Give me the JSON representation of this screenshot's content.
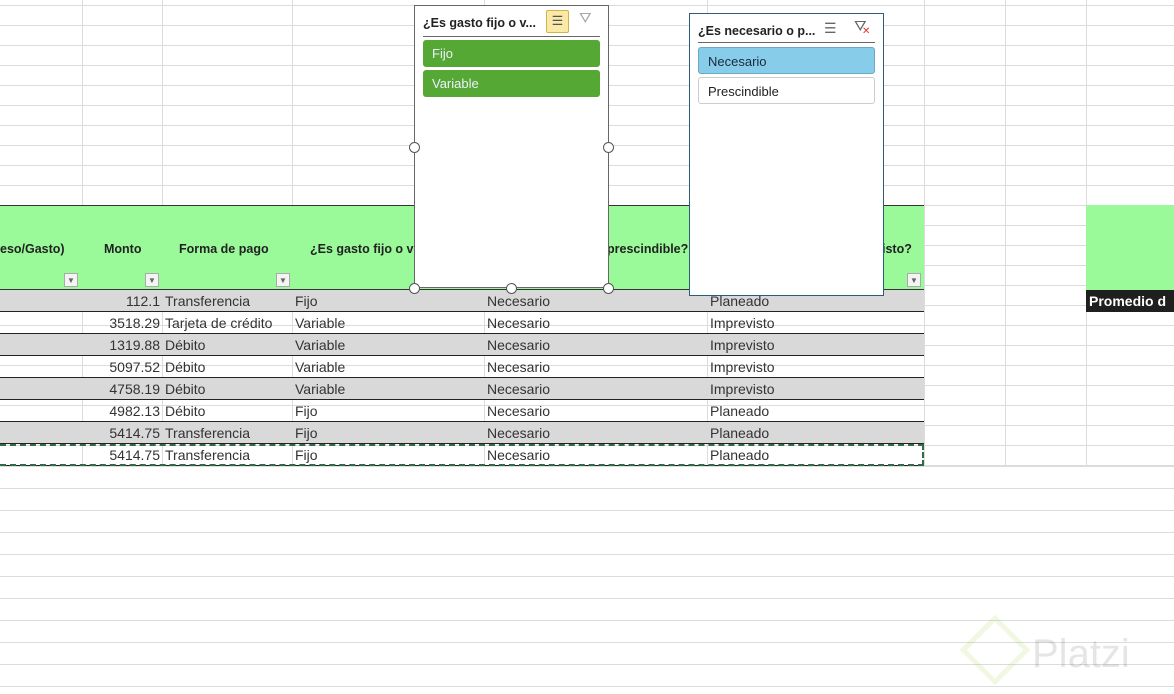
{
  "table": {
    "headers": [
      "eso/Gasto)",
      "Monto",
      "Forma de pago",
      "¿Es gasto fijo o v",
      "prescindible?",
      "isto?"
    ],
    "rows": [
      {
        "monto": "112.1",
        "forma": "Transferencia",
        "fijo": "Fijo",
        "necesario": "Necesario",
        "plan": "Planeado"
      },
      {
        "monto": "3518.29",
        "forma": "Tarjeta de crédito",
        "fijo": "Variable",
        "necesario": "Necesario",
        "plan": "Imprevisto"
      },
      {
        "monto": "1319.88",
        "forma": "Débito",
        "fijo": "Variable",
        "necesario": "Necesario",
        "plan": "Imprevisto"
      },
      {
        "monto": "5097.52",
        "forma": "Débito",
        "fijo": "Variable",
        "necesario": "Necesario",
        "plan": "Imprevisto"
      },
      {
        "monto": "4758.19",
        "forma": "Débito",
        "fijo": "Variable",
        "necesario": "Necesario",
        "plan": "Imprevisto"
      },
      {
        "monto": "4982.13",
        "forma": "Débito",
        "fijo": "Fijo",
        "necesario": "Necesario",
        "plan": "Planeado"
      },
      {
        "monto": "5414.75",
        "forma": "Transferencia",
        "fijo": "Fijo",
        "necesario": "Necesario",
        "plan": "Planeado"
      },
      {
        "monto": "5414.75",
        "forma": "Transferencia",
        "fijo": "Fijo",
        "necesario": "Necesario",
        "plan": "Planeado"
      }
    ]
  },
  "side": {
    "label": "Promedio d"
  },
  "slicer1": {
    "title": "¿Es gasto fijo o v...",
    "items": [
      "Fijo",
      "Variable"
    ]
  },
  "slicer2": {
    "title": "¿Es necesario o p...",
    "items": [
      "Necesario",
      "Prescindible"
    ]
  },
  "watermark": "Platzi",
  "colors": {
    "header": "#9afa9a",
    "slicer_green": "#55a834",
    "slicer_blue": "#87cdea"
  }
}
